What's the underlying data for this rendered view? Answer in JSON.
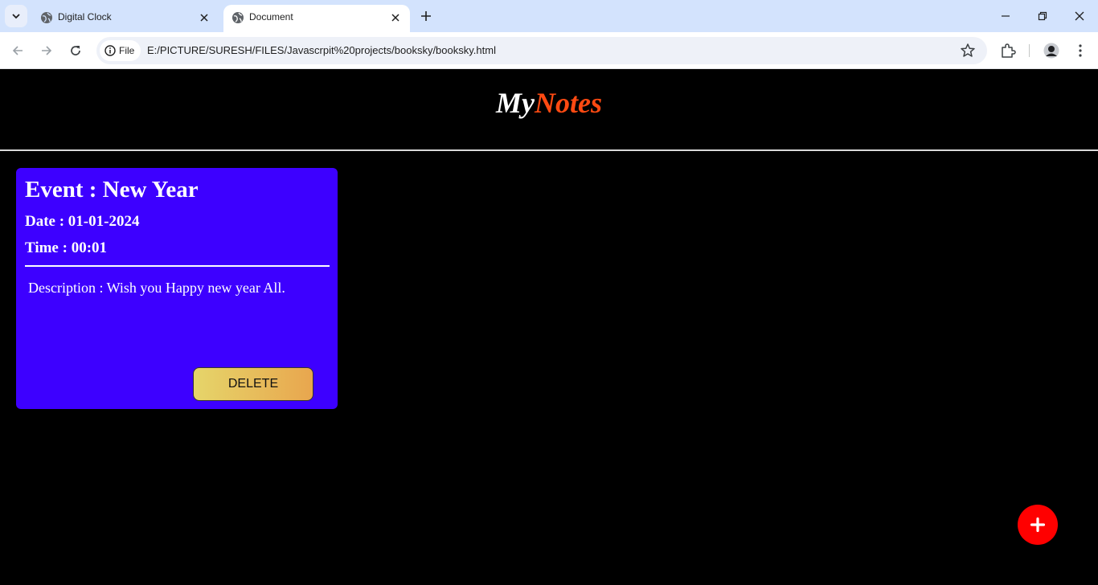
{
  "browser": {
    "tabs": [
      {
        "title": "Digital Clock",
        "active": false
      },
      {
        "title": "Document",
        "active": true
      }
    ],
    "chip_label": "File",
    "url": "E:/PICTURE/SURESH/FILES/Javascrpit%20projects/booksky/booksky.html"
  },
  "header": {
    "brand_my": "My",
    "brand_notes": "Notes"
  },
  "notes": [
    {
      "event": "Event : New Year",
      "date": "Date : 01-01-2024",
      "time": "Time : 00:01",
      "description": "Description : Wish you Happy new year All.",
      "delete_label": "DELETE"
    }
  ],
  "colors": {
    "card_bg": "#3d00ff",
    "brand_accent": "#ff4a12",
    "fab": "#ff0000"
  }
}
